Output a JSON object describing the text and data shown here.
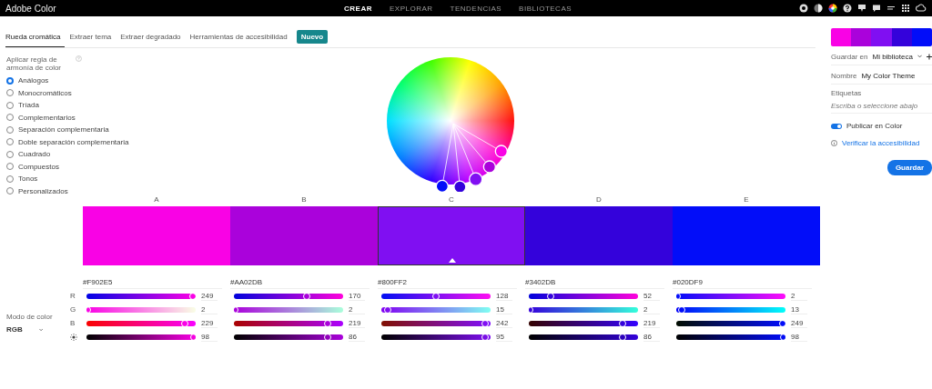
{
  "app": {
    "title": "Adobe Color"
  },
  "nav": [
    {
      "label": "CREAR",
      "selected": true
    },
    {
      "label": "EXPLORAR",
      "selected": false
    },
    {
      "label": "TENDENCIAS",
      "selected": false
    },
    {
      "label": "BIBLIOTECAS",
      "selected": false
    }
  ],
  "tabs": [
    {
      "label": "Rueda cromática",
      "selected": true
    },
    {
      "label": "Extraer tema",
      "selected": false
    },
    {
      "label": "Extraer degradado",
      "selected": false
    },
    {
      "label": "Herramientas de accesibilidad",
      "selected": false,
      "badge": "Nuevo"
    }
  ],
  "harmony": {
    "title": "Aplicar regla de armonía de color",
    "options": [
      {
        "label": "Análogos",
        "selected": true
      },
      {
        "label": "Monocromáticos",
        "selected": false
      },
      {
        "label": "Tríada",
        "selected": false
      },
      {
        "label": "Complementarios",
        "selected": false
      },
      {
        "label": "Separación complementaria",
        "selected": false
      },
      {
        "label": "Doble separación complementaria",
        "selected": false
      },
      {
        "label": "Cuadrado",
        "selected": false
      },
      {
        "label": "Compuestos",
        "selected": false
      },
      {
        "label": "Tonos",
        "selected": false
      },
      {
        "label": "Personalizados",
        "selected": false
      }
    ]
  },
  "channel_labels": [
    "R",
    "G",
    "B"
  ],
  "color_mode": {
    "label": "Modo de color",
    "value": "RGB"
  },
  "swatches": [
    {
      "letter": "A",
      "hex": "#F902E5",
      "selected": false,
      "sliders": [
        {
          "value": "249",
          "level": 0.976
        },
        {
          "value": "2",
          "level": 0.008
        },
        {
          "value": "229",
          "level": 0.898
        },
        {
          "value": "98",
          "level": 0.98
        }
      ]
    },
    {
      "letter": "B",
      "hex": "#AA02DB",
      "selected": false,
      "sliders": [
        {
          "value": "170",
          "level": 0.667
        },
        {
          "value": "2",
          "level": 0.008
        },
        {
          "value": "219",
          "level": 0.859
        },
        {
          "value": "86",
          "level": 0.86
        }
      ]
    },
    {
      "letter": "C",
      "hex": "#800FF2",
      "selected": true,
      "sliders": [
        {
          "value": "128",
          "level": 0.502
        },
        {
          "value": "15",
          "level": 0.059
        },
        {
          "value": "242",
          "level": 0.949
        },
        {
          "value": "95",
          "level": 0.95
        }
      ]
    },
    {
      "letter": "D",
      "hex": "#3402DB",
      "selected": false,
      "sliders": [
        {
          "value": "52",
          "level": 0.204
        },
        {
          "value": "2",
          "level": 0.008
        },
        {
          "value": "219",
          "level": 0.859
        },
        {
          "value": "86",
          "level": 0.86
        }
      ]
    },
    {
      "letter": "E",
      "hex": "#020DF9",
      "selected": false,
      "sliders": [
        {
          "value": "2",
          "level": 0.008
        },
        {
          "value": "13",
          "level": 0.051
        },
        {
          "value": "249",
          "level": 0.976
        },
        {
          "value": "98",
          "level": 0.98
        }
      ]
    }
  ],
  "save_panel": {
    "library_label": "Guardar en",
    "library": "Mi biblioteca",
    "name_label": "Nombre",
    "name": "My Color Theme",
    "tags_label": "Etiquetas",
    "tags_placeholder": "Escriba o seleccione abajo",
    "publish_label": "Publicar en Color",
    "publish_on": true,
    "accessibility_link": "Verificar la accesibilidad",
    "save_button": "Guardar"
  }
}
